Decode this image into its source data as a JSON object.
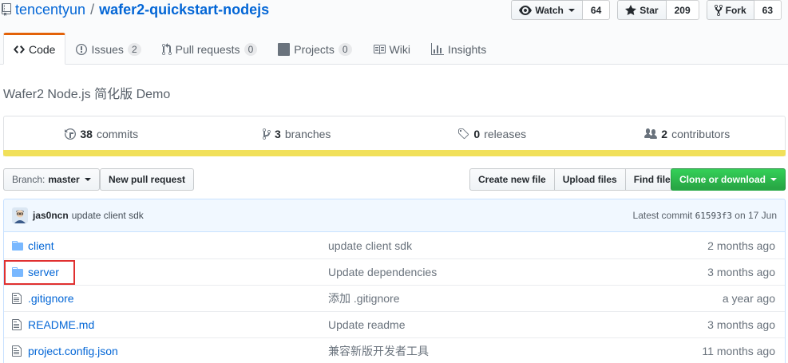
{
  "repo": {
    "owner": "tencentyun",
    "separator": "/",
    "name": "wafer2-quickstart-nodejs",
    "description": "Wafer2 Node.js 简化版 Demo"
  },
  "actions": {
    "watch": {
      "label": "Watch",
      "count": "64"
    },
    "star": {
      "label": "Star",
      "count": "209"
    },
    "fork": {
      "label": "Fork",
      "count": "63"
    }
  },
  "nav": {
    "tabs": [
      {
        "label": "Code",
        "icon": "code-icon"
      },
      {
        "label": "Issues",
        "count": "2",
        "icon": "issue-icon"
      },
      {
        "label": "Pull requests",
        "count": "0",
        "icon": "pull-request-icon"
      },
      {
        "label": "Projects",
        "count": "0",
        "icon": "project-icon"
      },
      {
        "label": "Wiki",
        "icon": "book-icon"
      },
      {
        "label": "Insights",
        "icon": "graph-icon"
      }
    ]
  },
  "summary": {
    "commits": {
      "num": "38",
      "label": "commits"
    },
    "branches": {
      "num": "3",
      "label": "branches"
    },
    "releases": {
      "num": "0",
      "label": "releases"
    },
    "contributors": {
      "num": "2",
      "label": "contributors"
    },
    "language_color": "#f1e05a"
  },
  "file_nav": {
    "branch_prefix": "Branch:",
    "branch": "master",
    "new_pr": "New pull request",
    "create_file": "Create new file",
    "upload_files": "Upload files",
    "find_file": "Find file",
    "clone": "Clone or download"
  },
  "latest_commit": {
    "author": "jas0ncn",
    "message": "update client sdk",
    "prefix": "Latest commit",
    "sha": "61593f3",
    "date": "on 17 Jun"
  },
  "files": [
    {
      "name": "client",
      "type": "dir",
      "message": "update client sdk",
      "age": "2 months ago"
    },
    {
      "name": "server",
      "type": "dir",
      "message": "Update dependencies",
      "age": "3 months ago"
    },
    {
      "name": ".gitignore",
      "type": "file",
      "message": "添加 .gitignore",
      "age": "a year ago"
    },
    {
      "name": "README.md",
      "type": "file",
      "message": "Update readme",
      "age": "3 months ago"
    },
    {
      "name": "project.config.json",
      "type": "file",
      "message": "兼容新版开发者工具",
      "age": "11 months ago"
    }
  ]
}
